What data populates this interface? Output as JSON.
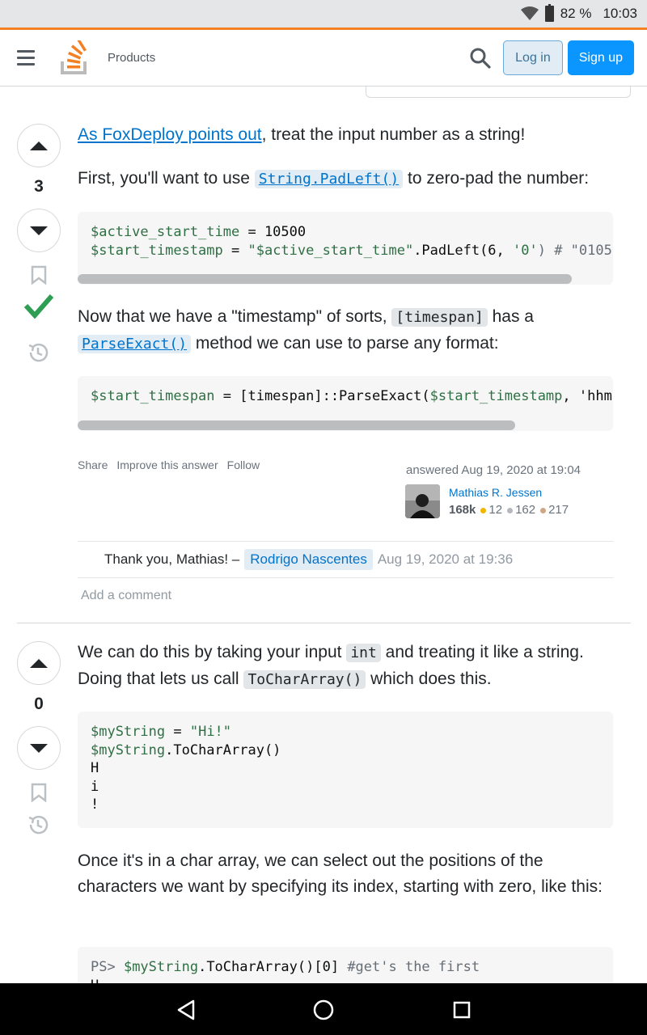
{
  "status_bar": {
    "battery": "82 %",
    "time": "10:03"
  },
  "header": {
    "products": "Products",
    "login": "Log in",
    "signup": "Sign up"
  },
  "answer1": {
    "votes": "3",
    "p1_link": "As FoxDeploy points out",
    "p1_rest": ", treat the input number as a string!",
    "p2_a": "First, you'll want to use ",
    "p2_code": "String.PadLeft()",
    "p2_b": " to zero-pad the number:",
    "code1_line1_var": "$active_start_time",
    "code1_line1_rest": " = 10500",
    "code1_line2_var": "$start_timestamp",
    "code1_line2_eq": " = ",
    "code1_line2_str": "\"$active_start_time\"",
    "code1_line2_mid": ".PadLeft(6, ",
    "code1_line2_str2": "'0'",
    "code1_line2_cmt": ") # \"0105",
    "p3_a": "Now that we have a \"timestamp\" of sorts, ",
    "p3_code": "[timespan]",
    "p3_b": " has a",
    "p3_code2": "ParseExact()",
    "p3_c": " method we can use to parse any format:",
    "code2_var": "$start_timespan",
    "code2_mid": " = [timespan]::ParseExact(",
    "code2_var2": "$start_timestamp",
    "code2_end": ", 'hhm",
    "share": "Share",
    "improve": "Improve this answer",
    "follow": "Follow",
    "answered": "answered Aug 19, 2020 at 19:04",
    "user": "Mathias R. Jessen",
    "rep": "168k",
    "gold": "12",
    "silver": "162",
    "bronze": "217",
    "comment_text": "Thank you, Mathias! –",
    "comment_user": "Rodrigo Nascentes",
    "comment_date": "Aug 19, 2020 at 19:36",
    "add_comment": "Add a comment"
  },
  "answer2": {
    "votes": "0",
    "p1_a": "We can do this by taking your input ",
    "p1_code": "int",
    "p1_b": " and treating it like a string.",
    "p1_c": "Doing that lets us call ",
    "p1_code2": "ToCharArray()",
    "p1_d": " which does this.",
    "code_l1_var": "$myString",
    "code_l1_eq": " = ",
    "code_l1_str": "\"Hi!\"",
    "code_l2_var": "$myString",
    "code_l2_rest": ".ToCharArray()",
    "code_l3": "H",
    "code_l4": "i",
    "code_l5": "!",
    "p2": "Once it's in a char array, we can select out the positions of the characters we want by specifying its index, starting with zero, like this:",
    "code2_prompt": "PS> ",
    "code2_var": "$myString",
    "code2_mid": ".ToCharArray()[0] ",
    "code2_cmt": "#get's the first",
    "code2_l2": "H"
  },
  "colors": {
    "accent": "#f48225",
    "link": "#0074cc",
    "accepted": "#2f9e55",
    "signup": "#0a95ff"
  },
  "icons": [
    "wifi-icon",
    "battery-icon",
    "hamburger-icon",
    "stackoverflow-logo",
    "search-icon",
    "upvote-icon",
    "downvote-icon",
    "bookmark-icon",
    "accepted-check-icon",
    "history-icon",
    "back-icon",
    "home-icon",
    "recents-icon"
  ]
}
